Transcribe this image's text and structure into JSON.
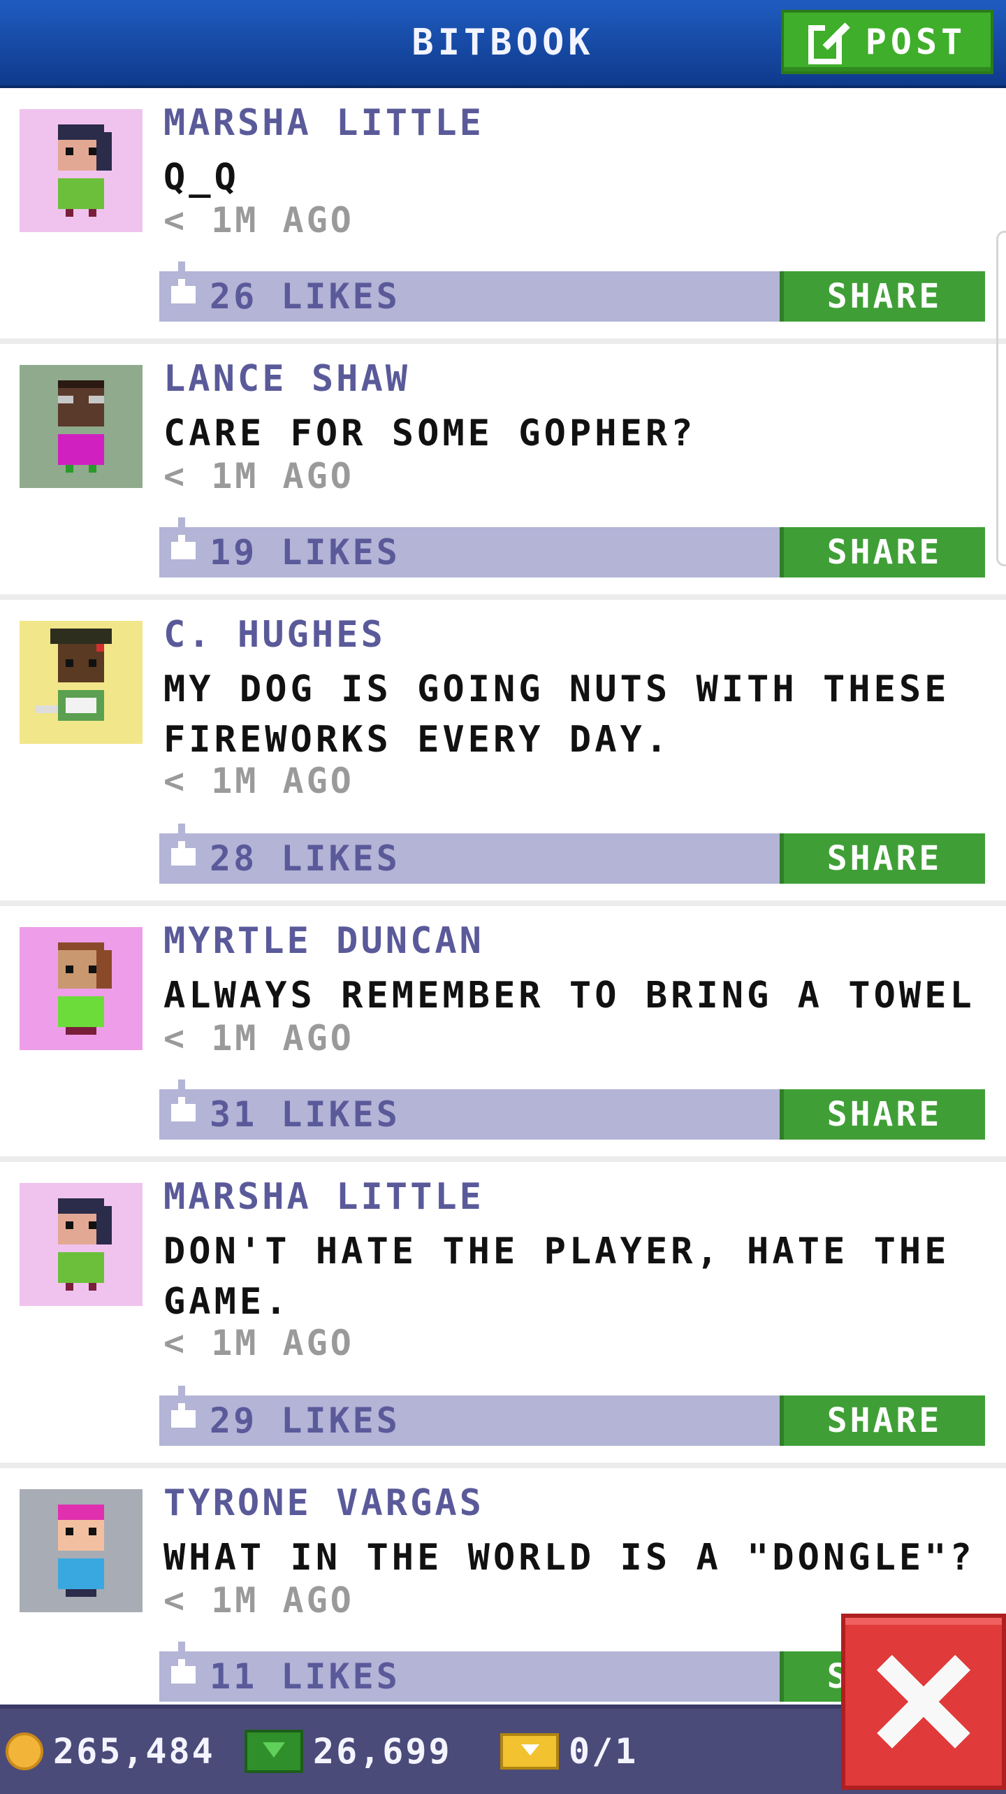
{
  "header": {
    "title": "BITBOOK",
    "post_label": "POST"
  },
  "posts": [
    {
      "author": "MARSHA LITTLE",
      "message": "Q_Q",
      "time": "< 1M AGO",
      "likes": "26 LIKES",
      "share": "SHARE",
      "avatar_bg": "#f0c3ee"
    },
    {
      "author": "LANCE SHAW",
      "message": "CARE FOR SOME GOPHER?",
      "time": "< 1M AGO",
      "likes": "19 LIKES",
      "share": "SHARE",
      "avatar_bg": "#8faa8c"
    },
    {
      "author": "C. HUGHES",
      "message": "MY DOG IS GOING NUTS WITH THESE FIREWORKS EVERY DAY.",
      "time": "< 1M AGO",
      "likes": "28 LIKES",
      "share": "SHARE",
      "avatar_bg": "#f2e68a"
    },
    {
      "author": "MYRTLE DUNCAN",
      "message": "ALWAYS REMEMBER TO BRING A TOWEL",
      "time": "< 1M AGO",
      "likes": "31 LIKES",
      "share": "SHARE",
      "avatar_bg": "#ee9ee8"
    },
    {
      "author": "MARSHA LITTLE",
      "message": "DON'T HATE THE PLAYER, HATE THE GAME.",
      "time": "< 1M AGO",
      "likes": "29 LIKES",
      "share": "SHARE",
      "avatar_bg": "#f0c3ee"
    },
    {
      "author": "TYRONE VARGAS",
      "message": "WHAT IN THE WORLD IS A \"DONGLE\"?",
      "time": "< 1M AGO",
      "likes": "11 LIKES",
      "share": "SHARE",
      "avatar_bg": "#a8acb4"
    }
  ],
  "footer": {
    "coins": "265,484",
    "bux": "26,699",
    "tickets": "0/1"
  },
  "colors": {
    "header": "#1f5cc0",
    "accent_green": "#3fae2a",
    "like_bar": "#b3b4d6",
    "author_text": "#5a5a9a",
    "footer": "#4b4b7a",
    "close": "#e03a3a"
  }
}
